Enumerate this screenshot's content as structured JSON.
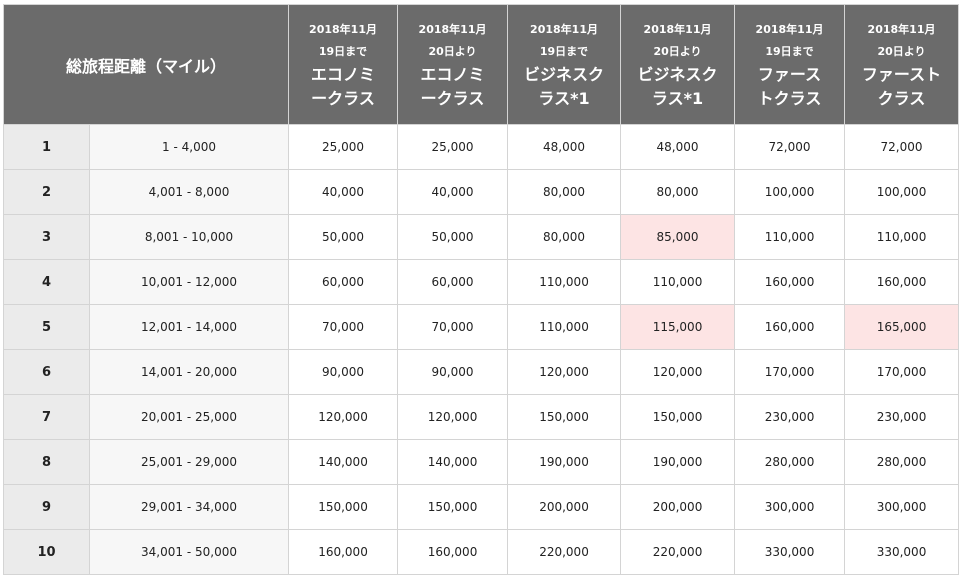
{
  "header": {
    "distance": "総旅程距離（マイル）",
    "columns": [
      {
        "date_line1": "2018年11月",
        "date_line2": "19日まで",
        "class_line1": "エコノミ",
        "class_line2": "ークラス"
      },
      {
        "date_line1": "2018年11月",
        "date_line2": "20日より",
        "class_line1": "エコノミ",
        "class_line2": "ークラス"
      },
      {
        "date_line1": "2018年11月",
        "date_line2": "19日まで",
        "class_line1": "ビジネスク",
        "class_line2": "ラス*1"
      },
      {
        "date_line1": "2018年11月",
        "date_line2": "20日より",
        "class_line1": "ビジネスク",
        "class_line2": "ラス*1"
      },
      {
        "date_line1": "2018年11月",
        "date_line2": "19日まで",
        "class_line1": "ファース",
        "class_line2": "トクラス"
      },
      {
        "date_line1": "2018年11月",
        "date_line2": "20日より",
        "class_line1": "ファースト",
        "class_line2": "クラス"
      }
    ]
  },
  "highlight_color": "#fde4e4",
  "rows": [
    {
      "zone": "1",
      "distance": "1 - 4,000",
      "values": [
        "25,000",
        "25,000",
        "48,000",
        "48,000",
        "72,000",
        "72,000"
      ],
      "highlight": [
        false,
        false,
        false,
        false,
        false,
        false
      ]
    },
    {
      "zone": "2",
      "distance": "4,001 - 8,000",
      "values": [
        "40,000",
        "40,000",
        "80,000",
        "80,000",
        "100,000",
        "100,000"
      ],
      "highlight": [
        false,
        false,
        false,
        false,
        false,
        false
      ]
    },
    {
      "zone": "3",
      "distance": "8,001 - 10,000",
      "values": [
        "50,000",
        "50,000",
        "80,000",
        "85,000",
        "110,000",
        "110,000"
      ],
      "highlight": [
        false,
        false,
        false,
        true,
        false,
        false
      ]
    },
    {
      "zone": "4",
      "distance": "10,001 - 12,000",
      "values": [
        "60,000",
        "60,000",
        "110,000",
        "110,000",
        "160,000",
        "160,000"
      ],
      "highlight": [
        false,
        false,
        false,
        false,
        false,
        false
      ]
    },
    {
      "zone": "5",
      "distance": "12,001 - 14,000",
      "values": [
        "70,000",
        "70,000",
        "110,000",
        "115,000",
        "160,000",
        "165,000"
      ],
      "highlight": [
        false,
        false,
        false,
        true,
        false,
        true
      ]
    },
    {
      "zone": "6",
      "distance": "14,001 - 20,000",
      "values": [
        "90,000",
        "90,000",
        "120,000",
        "120,000",
        "170,000",
        "170,000"
      ],
      "highlight": [
        false,
        false,
        false,
        false,
        false,
        false
      ]
    },
    {
      "zone": "7",
      "distance": "20,001 - 25,000",
      "values": [
        "120,000",
        "120,000",
        "150,000",
        "150,000",
        "230,000",
        "230,000"
      ],
      "highlight": [
        false,
        false,
        false,
        false,
        false,
        false
      ]
    },
    {
      "zone": "8",
      "distance": "25,001 - 29,000",
      "values": [
        "140,000",
        "140,000",
        "190,000",
        "190,000",
        "280,000",
        "280,000"
      ],
      "highlight": [
        false,
        false,
        false,
        false,
        false,
        false
      ]
    },
    {
      "zone": "9",
      "distance": "29,001 - 34,000",
      "values": [
        "150,000",
        "150,000",
        "200,000",
        "200,000",
        "300,000",
        "300,000"
      ],
      "highlight": [
        false,
        false,
        false,
        false,
        false,
        false
      ]
    },
    {
      "zone": "10",
      "distance": "34,001 - 50,000",
      "values": [
        "160,000",
        "160,000",
        "220,000",
        "220,000",
        "330,000",
        "330,000"
      ],
      "highlight": [
        false,
        false,
        false,
        false,
        false,
        false
      ]
    }
  ]
}
